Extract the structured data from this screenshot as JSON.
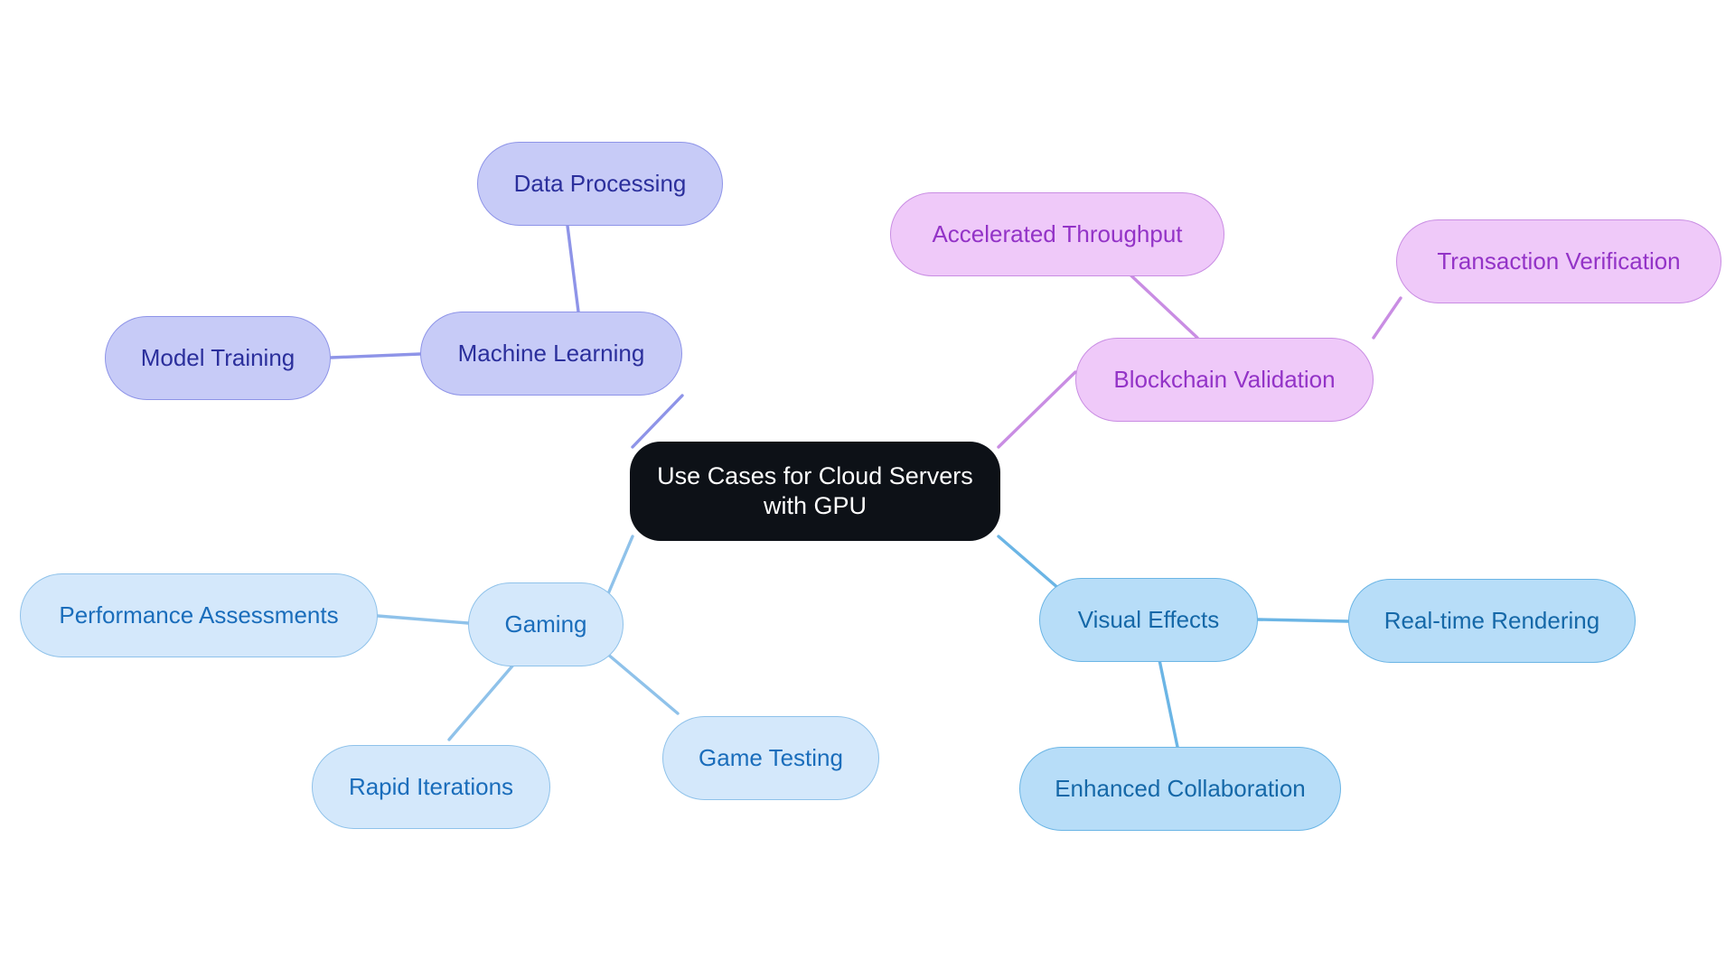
{
  "diagram": {
    "type": "mindmap",
    "title": "Use Cases for Cloud Servers with GPU",
    "background_color": "#ffffff",
    "root": {
      "id": "root",
      "label": "Use Cases for Cloud Servers\nwith GPU",
      "fill": "#0d1117",
      "text_color": "#ffffff"
    },
    "branches": [
      {
        "id": "machine-learning",
        "label": "Machine Learning",
        "fill": "#c7cbf7",
        "border": "#8e94e8",
        "text_color": "#2b2f9c",
        "children": [
          {
            "id": "data-processing",
            "label": "Data Processing"
          },
          {
            "id": "model-training",
            "label": "Model Training"
          }
        ]
      },
      {
        "id": "blockchain-validation",
        "label": "Blockchain Validation",
        "fill": "#efc9f9",
        "border": "#c98de3",
        "text_color": "#9333c7",
        "children": [
          {
            "id": "accelerated-throughput",
            "label": "Accelerated Throughput"
          },
          {
            "id": "transaction-verification",
            "label": "Transaction Verification"
          }
        ]
      },
      {
        "id": "gaming",
        "label": "Gaming",
        "fill": "#d4e8fb",
        "border": "#8fc2ea",
        "text_color": "#1a6dbb",
        "children": [
          {
            "id": "performance-assessments",
            "label": "Performance Assessments"
          },
          {
            "id": "rapid-iterations",
            "label": "Rapid Iterations"
          },
          {
            "id": "game-testing",
            "label": "Game Testing"
          }
        ]
      },
      {
        "id": "visual-effects",
        "label": "Visual Effects",
        "fill": "#b7ddf8",
        "border": "#6bb5e5",
        "text_color": "#1568a8",
        "children": [
          {
            "id": "real-time-rendering",
            "label": "Real-time Rendering"
          },
          {
            "id": "enhanced-collaboration",
            "label": "Enhanced Collaboration"
          }
        ]
      }
    ],
    "edges": [
      {
        "from": "root",
        "to": "machine-learning",
        "color": "#8e94e8"
      },
      {
        "from": "machine-learning",
        "to": "data-processing",
        "color": "#8e94e8"
      },
      {
        "from": "machine-learning",
        "to": "model-training",
        "color": "#8e94e8"
      },
      {
        "from": "root",
        "to": "blockchain-validation",
        "color": "#c98de3"
      },
      {
        "from": "blockchain-validation",
        "to": "accelerated-throughput",
        "color": "#c98de3"
      },
      {
        "from": "blockchain-validation",
        "to": "transaction-verification",
        "color": "#c98de3"
      },
      {
        "from": "root",
        "to": "gaming",
        "color": "#8fc2ea"
      },
      {
        "from": "gaming",
        "to": "performance-assessments",
        "color": "#8fc2ea"
      },
      {
        "from": "gaming",
        "to": "rapid-iterations",
        "color": "#8fc2ea"
      },
      {
        "from": "gaming",
        "to": "game-testing",
        "color": "#8fc2ea"
      },
      {
        "from": "root",
        "to": "visual-effects",
        "color": "#6bb5e5"
      },
      {
        "from": "visual-effects",
        "to": "real-time-rendering",
        "color": "#6bb5e5"
      },
      {
        "from": "visual-effects",
        "to": "enhanced-collaboration",
        "color": "#6bb5e5"
      }
    ]
  }
}
